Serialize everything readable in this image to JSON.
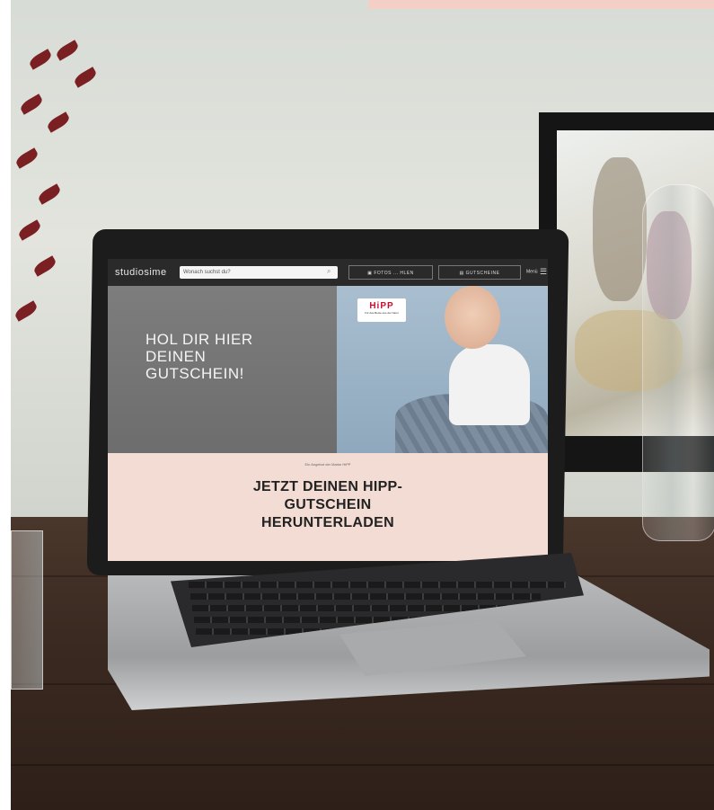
{
  "scene": {
    "banner_color": "#f4cfc5",
    "desk_color": "#3b2a21",
    "wall_color": "#dfe1da"
  },
  "website": {
    "logo": "studiosime",
    "search": {
      "placeholder": "Wonach suchst du?",
      "icon": "search-icon"
    },
    "nav_buttons": [
      {
        "label": "FOTOS ... HLEN",
        "icon": "photo-icon"
      },
      {
        "label": "GUTSCHEINE",
        "icon": "coupon-icon"
      }
    ],
    "menu_label": "Menü",
    "hero": {
      "headline": "HOL DIR HIER DEINEN GUTSCHEIN!",
      "brand_logo": "HiPP",
      "brand_tagline": "Für das Beste aus der Natur"
    },
    "promo": {
      "small_text": "Ein Angebot der Marke HiPP",
      "cta": "JETZT DEINEN HIPP-GUTSCHEIN HERUNTERLADEN"
    },
    "colors": {
      "nav_bg": "#2a2a2a",
      "promo_bg": "#f3dcd3",
      "brand_red": "#c8102e"
    }
  }
}
